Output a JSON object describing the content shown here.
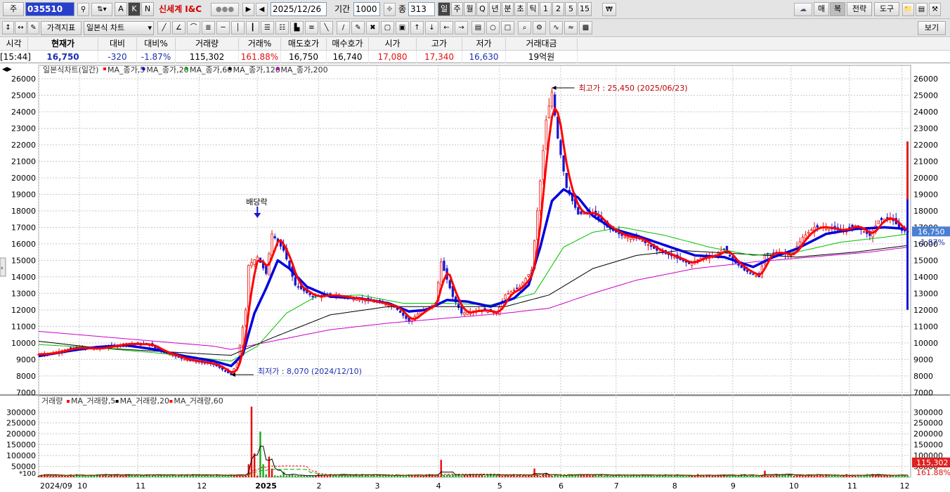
{
  "toolbar": {
    "market_btn": "주",
    "code": "035510",
    "name": "신세계 I&C",
    "btn_a": "A",
    "btn_k": "K",
    "btn_n": "N",
    "date": "2025/12/26",
    "period_label": "기간",
    "period_value": "1000",
    "count_label": "종",
    "count_value": "313",
    "periods": [
      "일",
      "주",
      "월",
      "Q",
      "년",
      "분",
      "초",
      "틱",
      "1",
      "2",
      "5",
      "15"
    ],
    "right_buttons": [
      "매",
      "복",
      "전략",
      "도구"
    ],
    "indicator_combo": "가격지표",
    "chart_type_combo": "일본식 차트",
    "view_btn": "보기"
  },
  "quote": {
    "headers": [
      "시각",
      "현재가",
      "대비",
      "대비%",
      "거래량",
      "거래%",
      "매도호가",
      "매수호가",
      "시가",
      "고가",
      "저가",
      "거래대금"
    ],
    "values": [
      "[15:44]",
      "16,750",
      "-320",
      "-1.87%",
      "115,302",
      "161.88%",
      "16,750",
      "16,740",
      "17,080",
      "17,340",
      "16,630",
      "19억원"
    ],
    "value_colors": [
      "#000000",
      "#1a2fb0",
      "#1a2fb0",
      "#1a2fb0",
      "#000000",
      "#e01010",
      "#000000",
      "#000000",
      "#e01010",
      "#e01010",
      "#1a2fb0",
      "#000000"
    ]
  },
  "colors": {
    "up": "#e81010",
    "down": "#1818d0",
    "ma5": "#ff0000",
    "ma20": "#0000dd",
    "ma60": "#00c000",
    "ma120": "#000000",
    "ma200": "#cc00cc",
    "grid": "#c8c8c8"
  },
  "chart_data": [
    {
      "type": "candlestick",
      "title": "일본식차트(일간)",
      "legend": [
        "MA_종가,5",
        "MA_종가,20",
        "MA_종가,60",
        "MA_종가,120",
        "MA_종가,200"
      ],
      "y_ticks": [
        26000,
        25000,
        24000,
        23000,
        22000,
        21000,
        20000,
        19000,
        18000,
        17000,
        16000,
        15000,
        14000,
        13000,
        12000,
        11000,
        10000,
        9000,
        8000,
        7000
      ],
      "ylim": [
        6800,
        26300
      ],
      "x_ticks": [
        "2024/09",
        "10",
        "11",
        "12",
        "2025",
        "2",
        "3",
        "4",
        "5",
        "6",
        "7",
        "8",
        "9",
        "10",
        "11",
        "12"
      ],
      "last_price_label": "16,750",
      "last_change_label": "-1.87%",
      "annotations": {
        "high": "최고가 : 25,450 (2025/06/23)",
        "low": "최저가 : 8,070 (2024/12/10)",
        "dividend": "배당락"
      },
      "price_path": [
        [
          0,
          9300
        ],
        [
          5,
          9400
        ],
        [
          12,
          9700
        ],
        [
          20,
          9650
        ],
        [
          30,
          9950
        ],
        [
          38,
          9900
        ],
        [
          42,
          9500
        ],
        [
          50,
          9000
        ],
        [
          60,
          8700
        ],
        [
          62,
          8500
        ],
        [
          66,
          8070
        ],
        [
          68,
          8800
        ],
        [
          71,
          12000
        ],
        [
          72,
          14700
        ],
        [
          75,
          15200
        ],
        [
          78,
          14200
        ],
        [
          80,
          16600
        ],
        [
          84,
          15600
        ],
        [
          88,
          13500
        ],
        [
          94,
          12800
        ],
        [
          100,
          12900
        ],
        [
          108,
          12700
        ],
        [
          115,
          12500
        ],
        [
          122,
          12200
        ],
        [
          127,
          11300
        ],
        [
          131,
          11900
        ],
        [
          136,
          12400
        ],
        [
          138,
          14900
        ],
        [
          142,
          12800
        ],
        [
          145,
          11800
        ],
        [
          152,
          12000
        ],
        [
          157,
          11800
        ],
        [
          160,
          12900
        ],
        [
          165,
          13400
        ],
        [
          169,
          14400
        ],
        [
          172,
          19800
        ],
        [
          174,
          23500
        ],
        [
          176,
          25200
        ],
        [
          178,
          22400
        ],
        [
          181,
          19400
        ],
        [
          185,
          17800
        ],
        [
          190,
          17900
        ],
        [
          195,
          17000
        ],
        [
          200,
          16500
        ],
        [
          206,
          16300
        ],
        [
          212,
          15600
        ],
        [
          218,
          15200
        ],
        [
          223,
          14800
        ],
        [
          228,
          15200
        ],
        [
          232,
          15300
        ],
        [
          235,
          15700
        ],
        [
          238,
          15000
        ],
        [
          242,
          14400
        ],
        [
          247,
          14000
        ],
        [
          249,
          15300
        ],
        [
          253,
          15500
        ],
        [
          258,
          15300
        ],
        [
          262,
          16400
        ],
        [
          266,
          17000
        ],
        [
          270,
          17000
        ],
        [
          275,
          16800
        ],
        [
          280,
          17100
        ],
        [
          285,
          16500
        ],
        [
          288,
          17400
        ],
        [
          292,
          17600
        ],
        [
          296,
          16800
        ],
        [
          298,
          16750
        ]
      ],
      "ma20_path": [
        [
          0,
          9200
        ],
        [
          10,
          9500
        ],
        [
          20,
          9750
        ],
        [
          30,
          9850
        ],
        [
          40,
          9600
        ],
        [
          50,
          9200
        ],
        [
          60,
          8900
        ],
        [
          66,
          8600
        ],
        [
          70,
          9300
        ],
        [
          74,
          11800
        ],
        [
          78,
          13300
        ],
        [
          82,
          15000
        ],
        [
          86,
          14500
        ],
        [
          92,
          13400
        ],
        [
          100,
          12800
        ],
        [
          110,
          12700
        ],
        [
          120,
          12400
        ],
        [
          127,
          11900
        ],
        [
          133,
          12000
        ],
        [
          140,
          12600
        ],
        [
          147,
          12500
        ],
        [
          155,
          12200
        ],
        [
          163,
          12700
        ],
        [
          168,
          13500
        ],
        [
          172,
          15800
        ],
        [
          176,
          18600
        ],
        [
          180,
          19300
        ],
        [
          185,
          18800
        ],
        [
          190,
          17700
        ],
        [
          197,
          16900
        ],
        [
          205,
          16500
        ],
        [
          215,
          15900
        ],
        [
          225,
          15300
        ],
        [
          235,
          15200
        ],
        [
          245,
          14600
        ],
        [
          252,
          15200
        ],
        [
          260,
          15700
        ],
        [
          270,
          16600
        ],
        [
          280,
          16900
        ],
        [
          290,
          17000
        ],
        [
          298,
          16900
        ]
      ],
      "ma60_path": [
        [
          0,
          9900
        ],
        [
          20,
          9700
        ],
        [
          40,
          9400
        ],
        [
          60,
          9000
        ],
        [
          66,
          8900
        ],
        [
          75,
          9800
        ],
        [
          85,
          11800
        ],
        [
          95,
          12800
        ],
        [
          110,
          12900
        ],
        [
          125,
          12400
        ],
        [
          140,
          12400
        ],
        [
          155,
          12300
        ],
        [
          170,
          13000
        ],
        [
          180,
          15800
        ],
        [
          190,
          16700
        ],
        [
          200,
          17000
        ],
        [
          215,
          16500
        ],
        [
          230,
          15800
        ],
        [
          245,
          15300
        ],
        [
          260,
          15500
        ],
        [
          275,
          16100
        ],
        [
          290,
          16400
        ],
        [
          298,
          16600
        ]
      ],
      "ma120_path": [
        [
          0,
          10100
        ],
        [
          20,
          9700
        ],
        [
          40,
          9500
        ],
        [
          60,
          9300
        ],
        [
          66,
          9250
        ],
        [
          80,
          10300
        ],
        [
          100,
          11700
        ],
        [
          120,
          12200
        ],
        [
          140,
          12200
        ],
        [
          160,
          12200
        ],
        [
          175,
          12900
        ],
        [
          190,
          14500
        ],
        [
          205,
          15300
        ],
        [
          220,
          15600
        ],
        [
          240,
          15400
        ],
        [
          260,
          15200
        ],
        [
          280,
          15500
        ],
        [
          298,
          15900
        ]
      ],
      "ma200_path": [
        [
          0,
          10700
        ],
        [
          20,
          10400
        ],
        [
          40,
          10100
        ],
        [
          60,
          9800
        ],
        [
          66,
          9600
        ],
        [
          80,
          10100
        ],
        [
          100,
          10800
        ],
        [
          120,
          11200
        ],
        [
          140,
          11500
        ],
        [
          160,
          11800
        ],
        [
          175,
          12100
        ],
        [
          190,
          13000
        ],
        [
          205,
          13800
        ],
        [
          225,
          14500
        ],
        [
          245,
          14900
        ],
        [
          265,
          15200
        ],
        [
          285,
          15500
        ],
        [
          298,
          15800
        ]
      ]
    },
    {
      "type": "bar",
      "title": "거래량",
      "legend": [
        "MA_거래량,5",
        "MA_거래량,20",
        "MA_거래량,60"
      ],
      "y_ticks": [
        300000,
        250000,
        200000,
        150000,
        100000,
        50000,
        0
      ],
      "ylim": [
        0,
        330000
      ],
      "unit_label": "*100",
      "last_volume_label": "115,302",
      "last_ratio_label": "161.88%",
      "spikes": [
        [
          72,
          60000
        ],
        [
          73,
          325000
        ],
        [
          74,
          110000
        ],
        [
          76,
          210000
        ],
        [
          77,
          60000
        ],
        [
          79,
          95000
        ],
        [
          80,
          40000
        ],
        [
          84,
          25000
        ],
        [
          138,
          80000
        ],
        [
          170,
          40000
        ],
        [
          174,
          20000
        ],
        [
          249,
          30000
        ],
        [
          286,
          15000
        ]
      ]
    }
  ]
}
